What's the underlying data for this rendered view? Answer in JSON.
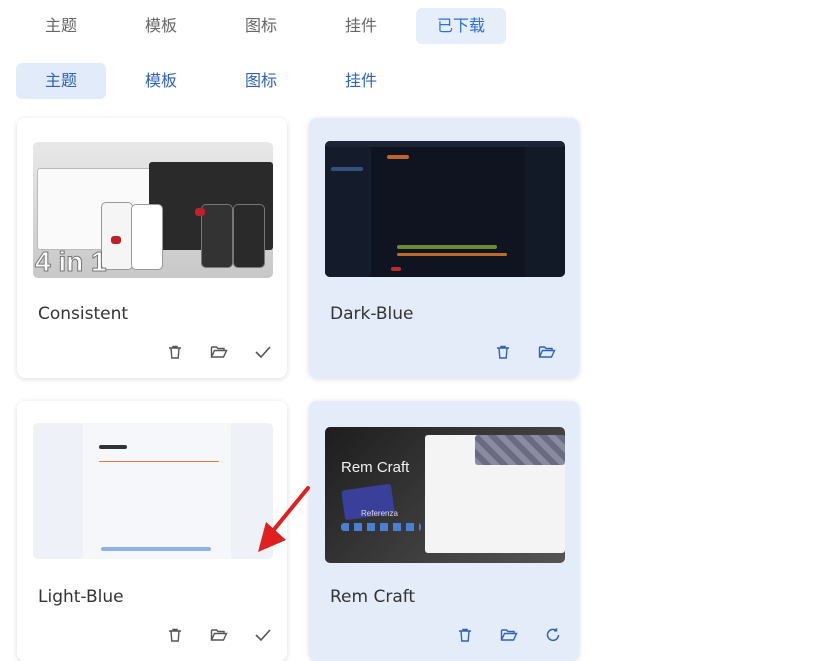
{
  "tabs_top": [
    {
      "label": "主题",
      "active": false
    },
    {
      "label": "模板",
      "active": false
    },
    {
      "label": "图标",
      "active": false
    },
    {
      "label": "挂件",
      "active": false
    },
    {
      "label": "已下载",
      "active": true
    }
  ],
  "tabs_sub": [
    {
      "label": "主题",
      "active": true
    },
    {
      "label": "模板",
      "active": false
    },
    {
      "label": "图标",
      "active": false
    },
    {
      "label": "挂件",
      "active": false
    }
  ],
  "cards": [
    {
      "name": "Consistent",
      "thumb_text": "4 in 1",
      "active": false,
      "actions": [
        "trash-icon",
        "folder-open-icon",
        "check-icon"
      ]
    },
    {
      "name": "Dark-Blue",
      "active": true,
      "actions": [
        "trash-icon",
        "folder-open-icon"
      ]
    },
    {
      "name": "Light-Blue",
      "active": false,
      "actions": [
        "trash-icon",
        "folder-open-icon",
        "check-icon"
      ]
    },
    {
      "name": "Rem Craft",
      "thumb_title": "Rem Craft",
      "thumb_sub": "Referenza",
      "active": true,
      "actions": [
        "trash-icon",
        "folder-open-icon",
        "refresh-icon"
      ]
    }
  ],
  "colors": {
    "accent": "#2f62b8",
    "active_bg": "#e4ecfa",
    "arrow": "#e02020"
  }
}
